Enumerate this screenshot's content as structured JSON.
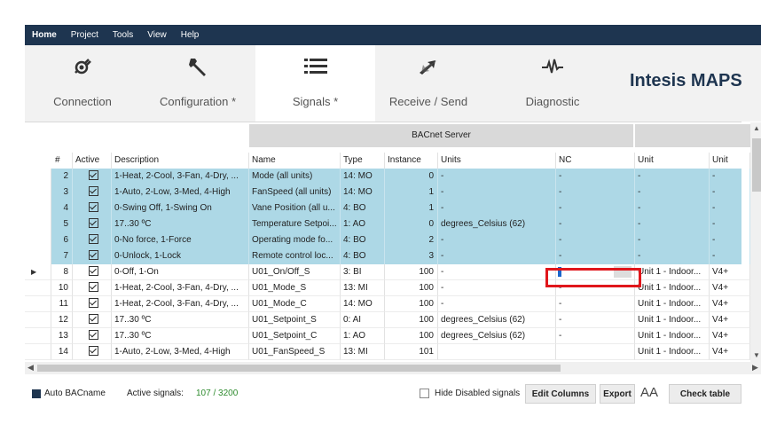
{
  "menu": [
    "Home",
    "Project",
    "Tools",
    "View",
    "Help"
  ],
  "toolbar": {
    "connection": "Connection",
    "configuration": "Configuration *",
    "signals": "Signals *",
    "receive_send": "Receive / Send",
    "diagnostic": "Diagnostic",
    "brand": "Intesis MAPS"
  },
  "grid": {
    "group_header": "BACnet Server",
    "headers": [
      "#",
      "Active",
      "Description",
      "Name",
      "Type",
      "Instance",
      "Units",
      "NC",
      "Unit",
      "Unit"
    ],
    "rows": [
      {
        "num": "2",
        "desc": "1-Heat, 2-Cool, 3-Fan, 4-Dry, ...",
        "name": "Mode (all units)",
        "type": "14: MO",
        "inst": "0",
        "units": "-",
        "nc": "-",
        "unit": "-",
        "unit2": "-",
        "highlight": true
      },
      {
        "num": "3",
        "desc": "1-Auto, 2-Low, 3-Med, 4-High",
        "name": "FanSpeed (all units)",
        "type": "14: MO",
        "inst": "1",
        "units": "-",
        "nc": "-",
        "unit": "-",
        "unit2": "-",
        "highlight": true
      },
      {
        "num": "4",
        "desc": "0-Swing Off, 1-Swing On",
        "name": "Vane Position (all u...",
        "type": "4: BO",
        "inst": "1",
        "units": "-",
        "nc": "-",
        "unit": "-",
        "unit2": "-",
        "highlight": true
      },
      {
        "num": "5",
        "desc": "17..30 ºC",
        "name": "Temperature Setpoi...",
        "type": "1: AO",
        "inst": "0",
        "units": "degrees_Celsius (62)",
        "nc": "-",
        "unit": "-",
        "unit2": "-",
        "highlight": true
      },
      {
        "num": "6",
        "desc": "0-No force, 1-Force",
        "name": "Operating mode fo...",
        "type": "4: BO",
        "inst": "2",
        "units": "-",
        "nc": "-",
        "unit": "-",
        "unit2": "-",
        "highlight": true
      },
      {
        "num": "7",
        "desc": "0-Unlock, 1-Lock",
        "name": "Remote control loc...",
        "type": "4: BO",
        "inst": "3",
        "units": "-",
        "nc": "-",
        "unit": "-",
        "unit2": "-",
        "highlight": true
      },
      {
        "num": "8",
        "desc": "0-Off, 1-On",
        "name": "U01_On/Off_S",
        "type": "3: BI",
        "inst": "100",
        "units": "-",
        "nc": "",
        "unit": "Unit 1 - Indoor...",
        "unit2": "V4+",
        "highlight": false,
        "current": true
      },
      {
        "num": "10",
        "desc": "1-Heat, 2-Cool, 3-Fan, 4-Dry, ...",
        "name": "U01_Mode_S",
        "type": "13: MI",
        "inst": "100",
        "units": "-",
        "nc": "-",
        "unit": "Unit 1 - Indoor...",
        "unit2": "V4+",
        "highlight": false
      },
      {
        "num": "11",
        "desc": "1-Heat, 2-Cool, 3-Fan, 4-Dry, ...",
        "name": "U01_Mode_C",
        "type": "14: MO",
        "inst": "100",
        "units": "-",
        "nc": "-",
        "unit": "Unit 1 - Indoor...",
        "unit2": "V4+",
        "highlight": false
      },
      {
        "num": "12",
        "desc": "17..30 ºC",
        "name": "U01_Setpoint_S",
        "type": "0: AI",
        "inst": "100",
        "units": "degrees_Celsius (62)",
        "nc": "-",
        "unit": "Unit 1 - Indoor...",
        "unit2": "V4+",
        "highlight": false
      },
      {
        "num": "13",
        "desc": "17..30 ºC",
        "name": "U01_Setpoint_C",
        "type": "1: AO",
        "inst": "100",
        "units": "degrees_Celsius (62)",
        "nc": "-",
        "unit": "Unit 1 - Indoor...",
        "unit2": "V4+",
        "highlight": false
      },
      {
        "num": "14",
        "desc": "1-Auto, 2-Low, 3-Med, 4-High",
        "name": "U01_FanSpeed_S",
        "type": "13: MI",
        "inst": "101",
        "units": "",
        "nc": "",
        "unit": "Unit 1 - Indoor...",
        "unit2": "V4+",
        "highlight": false
      }
    ]
  },
  "bottom": {
    "auto_bacname": "Auto BACname",
    "active_label": "Active signals:",
    "active_value": "107 / 3200",
    "hide_disabled": "Hide Disabled signals",
    "edit_columns": "Edit Columns",
    "export": "Export",
    "font_size": "AA",
    "check_table": "Check table"
  },
  "colors": {
    "menubar": "#1e3550",
    "row_highlight": "#add8e6",
    "active_count": "#2e8b2e",
    "annotation": "#e0161b"
  }
}
